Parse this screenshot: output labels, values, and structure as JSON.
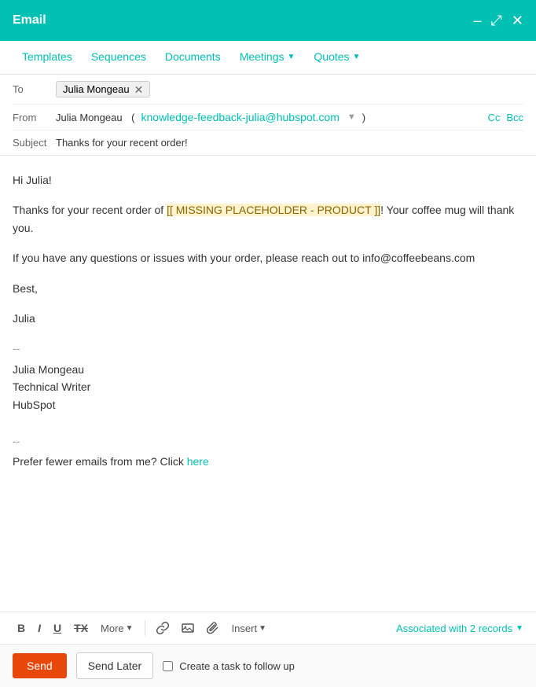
{
  "modal": {
    "title": "Email",
    "minimize_icon": "–",
    "expand_icon": "⤢",
    "close_icon": "✕"
  },
  "nav": {
    "tabs": [
      {
        "label": "Templates",
        "has_chevron": false
      },
      {
        "label": "Sequences",
        "has_chevron": false
      },
      {
        "label": "Documents",
        "has_chevron": false
      },
      {
        "label": "Meetings",
        "has_chevron": true
      },
      {
        "label": "Quotes",
        "has_chevron": true
      }
    ]
  },
  "fields": {
    "to_label": "To",
    "to_recipient": "Julia Mongeau",
    "from_label": "From",
    "from_name": "Julia Mongeau",
    "from_email": "knowledge-feedback-julia@hubspot.com",
    "cc_label": "Cc",
    "bcc_label": "Bcc",
    "subject_label": "Subject",
    "subject_value": "Thanks for your recent order!"
  },
  "body": {
    "greeting": "Hi Julia!",
    "line1": "Thanks for your recent order of ",
    "placeholder": "[[ MISSING PLACEHOLDER - PRODUCT ]]",
    "line1_end": "! Your coffee mug will thank you.",
    "line2": "If you have any questions or issues with your order, please reach out to info@coffeebeans.com",
    "closing": "Best,",
    "signature_name": "Julia",
    "sig_sep": "--",
    "sig_line1": "Julia Mongeau",
    "sig_line2": "Technical Writer",
    "sig_line3": "HubSpot",
    "footer_sep": "--",
    "footer_text": "Prefer fewer emails from me? Click ",
    "footer_link": "here"
  },
  "toolbar": {
    "bold": "B",
    "italic": "I",
    "underline": "U",
    "strikethrough": "TX",
    "more_label": "More",
    "more_chevron": "▾",
    "insert_label": "Insert",
    "insert_chevron": "▾",
    "associated_label": "Associated with 2 records",
    "associated_chevron": "▾"
  },
  "footer": {
    "send_label": "Send",
    "send_later_label": "Send Later",
    "followup_label": "Create a task to follow up"
  },
  "colors": {
    "teal": "#00bfb3",
    "orange": "#e8470a"
  }
}
